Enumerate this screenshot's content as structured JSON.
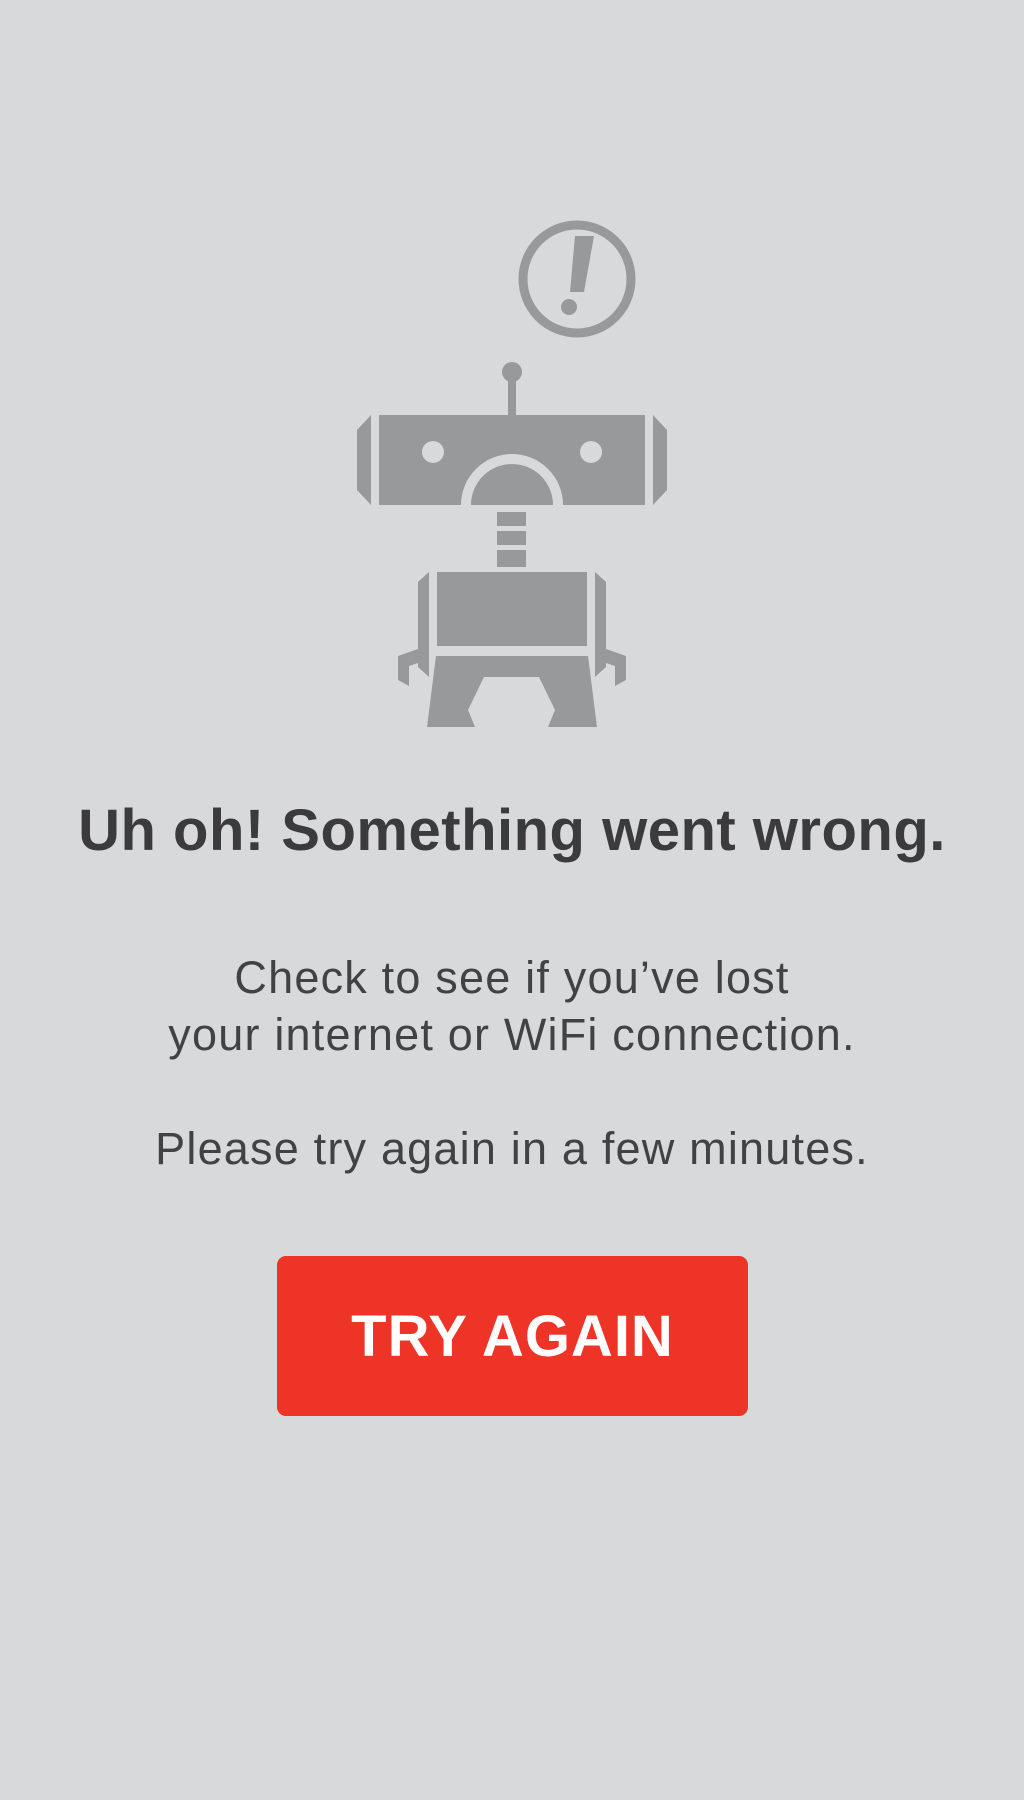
{
  "error_screen": {
    "illustration_icon": "sad-robot-with-exclamation-icon",
    "title": "Uh oh! Something went wrong.",
    "message_line_1": "Check to see if you’ve lost",
    "message_line_2": "your internet or WiFi connection.",
    "message_line_3": "Please try again in a few minutes.",
    "button_label": "TRY AGAIN"
  },
  "colors": {
    "background": "#d8d9db",
    "illustration": "#98999b",
    "text": "#3c3c3e",
    "button": "#ee3426",
    "button_text": "#ffffff"
  }
}
